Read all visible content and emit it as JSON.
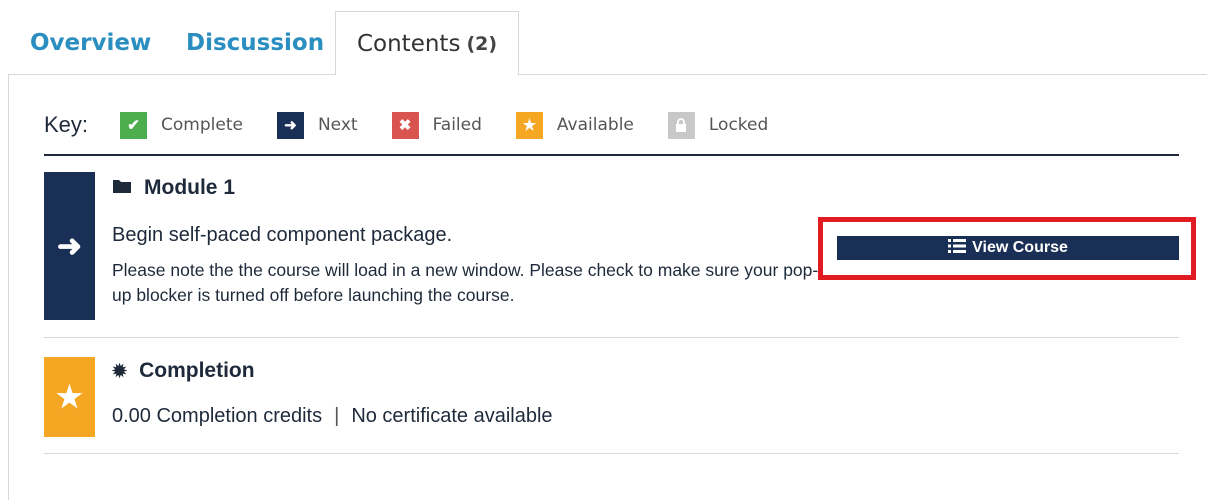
{
  "tabs": {
    "overview": "Overview",
    "discussion": "Discussion",
    "contents_label": "Contents",
    "contents_count": "(2)"
  },
  "key": {
    "title": "Key:",
    "items": [
      {
        "label": "Complete",
        "color": "#4cae4c",
        "icon": "check-icon",
        "glyph": "✓"
      },
      {
        "label": "Next",
        "color": "#1a2f55",
        "icon": "arrow-right-icon",
        "glyph": "➜"
      },
      {
        "label": "Failed",
        "color": "#d9534f",
        "icon": "x-icon",
        "glyph": "✖"
      },
      {
        "label": "Available",
        "color": "#f5a623",
        "icon": "star-icon",
        "glyph": "★"
      },
      {
        "label": "Locked",
        "color": "#c8c8c8",
        "icon": "lock-icon",
        "glyph": "🔒"
      }
    ]
  },
  "module": {
    "title": "Module 1",
    "icon": "folder-icon",
    "status": "Next",
    "description": "Begin self-paced component package.",
    "note": "Please note the the course will load in a new window. Please check to make sure your pop-up blocker is turned off before launching the course.",
    "button_label": "View Course",
    "button_icon": "list-icon"
  },
  "completion": {
    "title": "Completion",
    "icon": "badge-icon",
    "status": "Available",
    "credits": "0.00 Completion credits",
    "separator": "|",
    "certificate": "No certificate available"
  },
  "colors": {
    "accent": "#2b8ec0",
    "navy": "#1a2f55",
    "highlight": "#e01b22"
  }
}
